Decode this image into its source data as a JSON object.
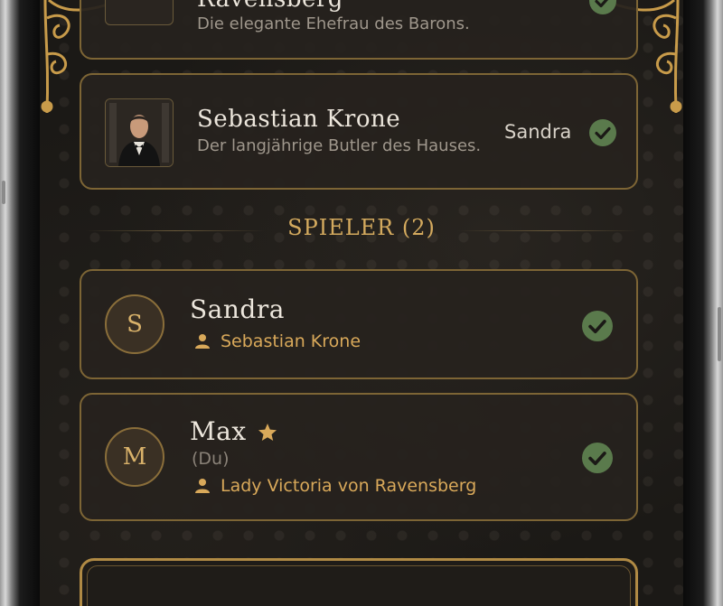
{
  "characters": [
    {
      "name": "Ravensberg",
      "description": "Die elegante Ehefrau des Barons.",
      "owner": "",
      "selected": true
    },
    {
      "name": "Sebastian Krone",
      "description": "Der langjährige Butler des Hauses.",
      "owner": "Sandra",
      "selected": true
    }
  ],
  "players_section": {
    "title": "SPIELER (2)"
  },
  "players": [
    {
      "initial": "S",
      "name": "Sandra",
      "note": "",
      "role": "Sebastian Krone",
      "ready": true,
      "host": false
    },
    {
      "initial": "M",
      "name": "Max",
      "note": "(Du)",
      "role": "Lady Victoria von Ravensberg",
      "ready": true,
      "host": true
    }
  ],
  "colors": {
    "accent_gold": "#d4aa5e",
    "check_green": "#5a7a4c",
    "card_border": "#7d6535"
  },
  "icons": {
    "check": "check-circle-icon",
    "person": "person-icon",
    "star": "star-icon"
  }
}
